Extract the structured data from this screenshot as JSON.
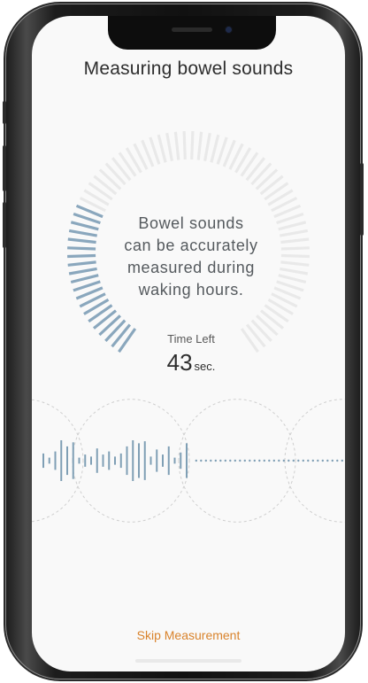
{
  "screen": {
    "title": "Measuring bowel sounds",
    "message_lines": [
      "Bowel sounds",
      "can be accurately",
      "measured during",
      "waking hours."
    ],
    "time_left": {
      "label": "Time Left",
      "value": "43",
      "unit": "sec."
    },
    "progress": {
      "elapsed_fraction": 0.28,
      "active_color": "#8aa7bd",
      "inactive_color": "#e9e9e9"
    },
    "waveform": {
      "color": "#7f9fb5",
      "guide_color": "#cfcfcf",
      "levels": [
        0.35,
        0.15,
        0.45,
        1.0,
        0.7,
        0.9,
        0.15,
        0.3,
        0.2,
        0.6,
        0.3,
        0.45,
        0.2,
        0.35,
        0.7,
        1.0,
        0.85,
        0.95,
        0.2,
        0.55,
        0.3,
        0.7,
        0.15,
        0.4,
        0.85
      ]
    },
    "skip_label": "Skip Measurement",
    "accent_color": "#d9832c"
  }
}
